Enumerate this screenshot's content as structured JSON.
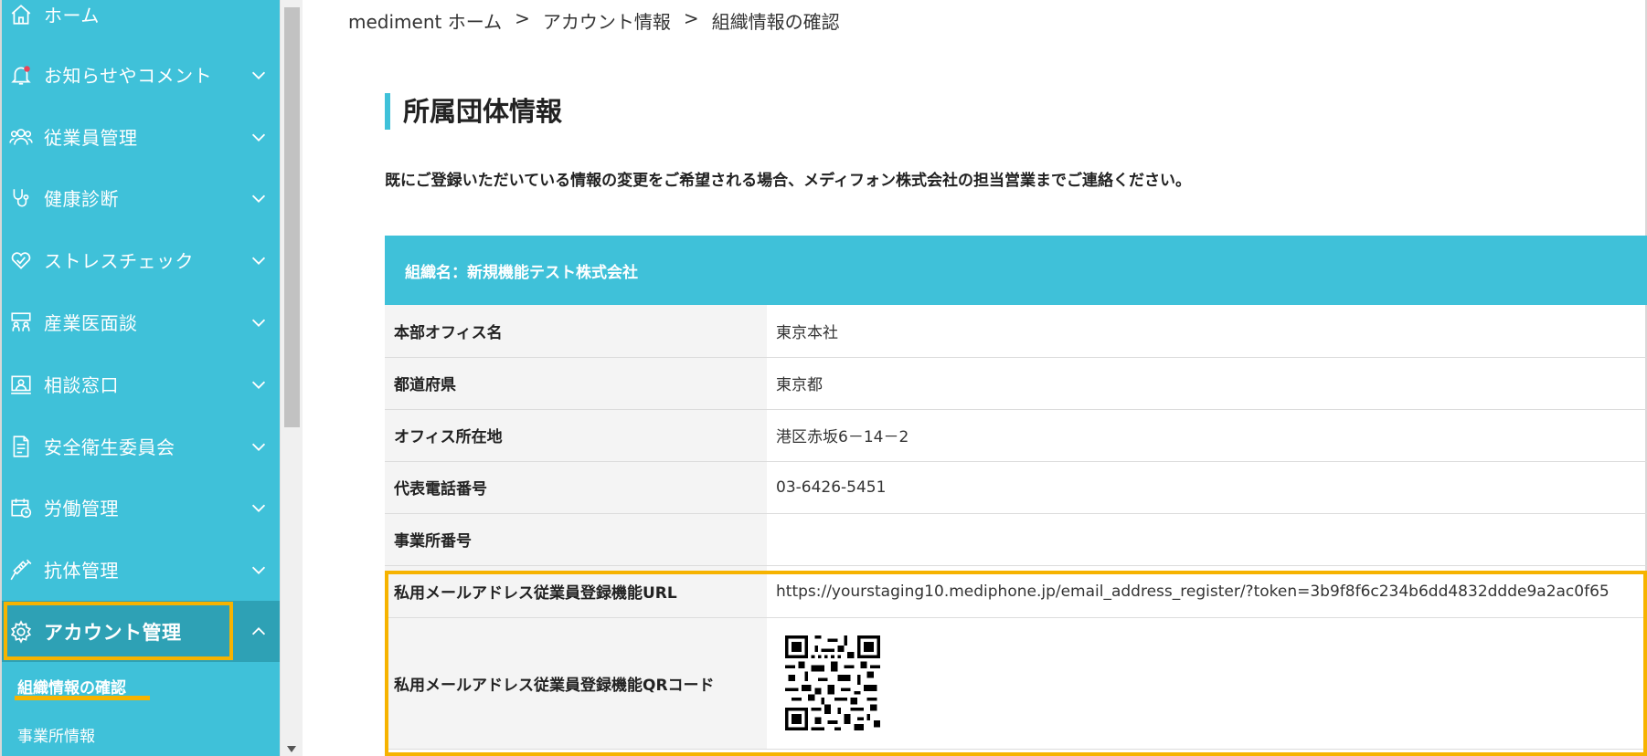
{
  "sidebar": {
    "items": [
      {
        "label": "ホーム",
        "icon": "home-icon"
      },
      {
        "label": "お知らせやコメント",
        "icon": "bell-icon"
      },
      {
        "label": "従業員管理",
        "icon": "users-icon"
      },
      {
        "label": "健康診断",
        "icon": "stethoscope-icon"
      },
      {
        "label": "ストレスチェック",
        "icon": "heart-icon"
      },
      {
        "label": "産業医面談",
        "icon": "meeting-icon"
      },
      {
        "label": "相談窓口",
        "icon": "consultation-icon"
      },
      {
        "label": "安全衛生委員会",
        "icon": "document-icon"
      },
      {
        "label": "労働管理",
        "icon": "calendar-clock-icon"
      },
      {
        "label": "抗体管理",
        "icon": "syringe-icon"
      },
      {
        "label": "アカウント管理",
        "icon": "gear-icon"
      }
    ],
    "sub_items": [
      {
        "label": "組織情報の確認"
      },
      {
        "label": "事業所情報"
      }
    ]
  },
  "breadcrumb": {
    "home": "mediment ホーム",
    "sep1": ">",
    "account": "アカウント情報",
    "sep2": ">",
    "current": "組織情報の確認"
  },
  "page": {
    "title": "所属団体情報",
    "notice": "既にご登録いただいている情報の変更をご希望される場合、メディフォン株式会社の担当営業までご連絡ください。"
  },
  "org": {
    "header": "組織名：新規機能テスト株式会社",
    "rows": [
      {
        "label": "本部オフィス名",
        "value": "東京本社"
      },
      {
        "label": "都道府県",
        "value": "東京都"
      },
      {
        "label": "オフィス所在地",
        "value": "港区赤坂6－14－2"
      },
      {
        "label": "代表電話番号",
        "value": "03-6426-5451"
      },
      {
        "label": "事業所番号",
        "value": ""
      },
      {
        "label": "私用メールアドレス従業員登録機能URL",
        "value": "https://yourstaging10.mediphone.jp/email_address_register/?token=3b9f8f6c234b6dd4832ddde9a2ac0f65"
      },
      {
        "label": "私用メールアドレス従業員登録機能QRコード",
        "value": ""
      }
    ]
  },
  "colors": {
    "accent": "#3fc1d9",
    "accent_dark": "#2ea1b5",
    "highlight": "#f6b300"
  }
}
